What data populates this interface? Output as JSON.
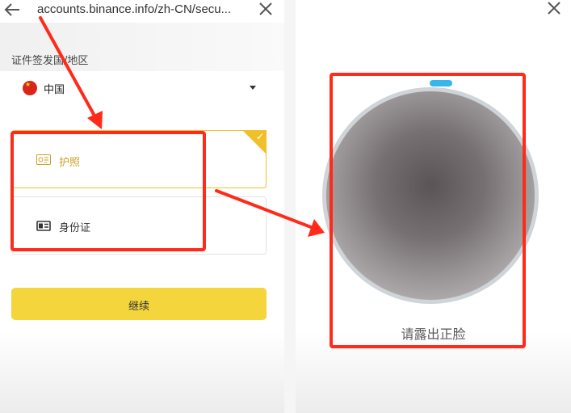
{
  "browser": {
    "url": "accounts.binance.info/zh-CN/secu..."
  },
  "form": {
    "section_label": "证件签发国/地区",
    "country": "中国",
    "options": [
      {
        "label": "护照",
        "selected": true
      },
      {
        "label": "身份证",
        "selected": false
      }
    ],
    "continue_label": "继续"
  },
  "face_scan": {
    "prompt": "请露出正脸"
  },
  "colors": {
    "accent": "#f0c02a",
    "button": "#f4d53c",
    "annotation": "#ff2a1a",
    "progress": "#37b6e8"
  },
  "icons": [
    "back-arrow-icon",
    "close-icon",
    "flag-icon",
    "caret-down-icon",
    "passport-icon",
    "id-card-icon",
    "check-icon"
  ]
}
